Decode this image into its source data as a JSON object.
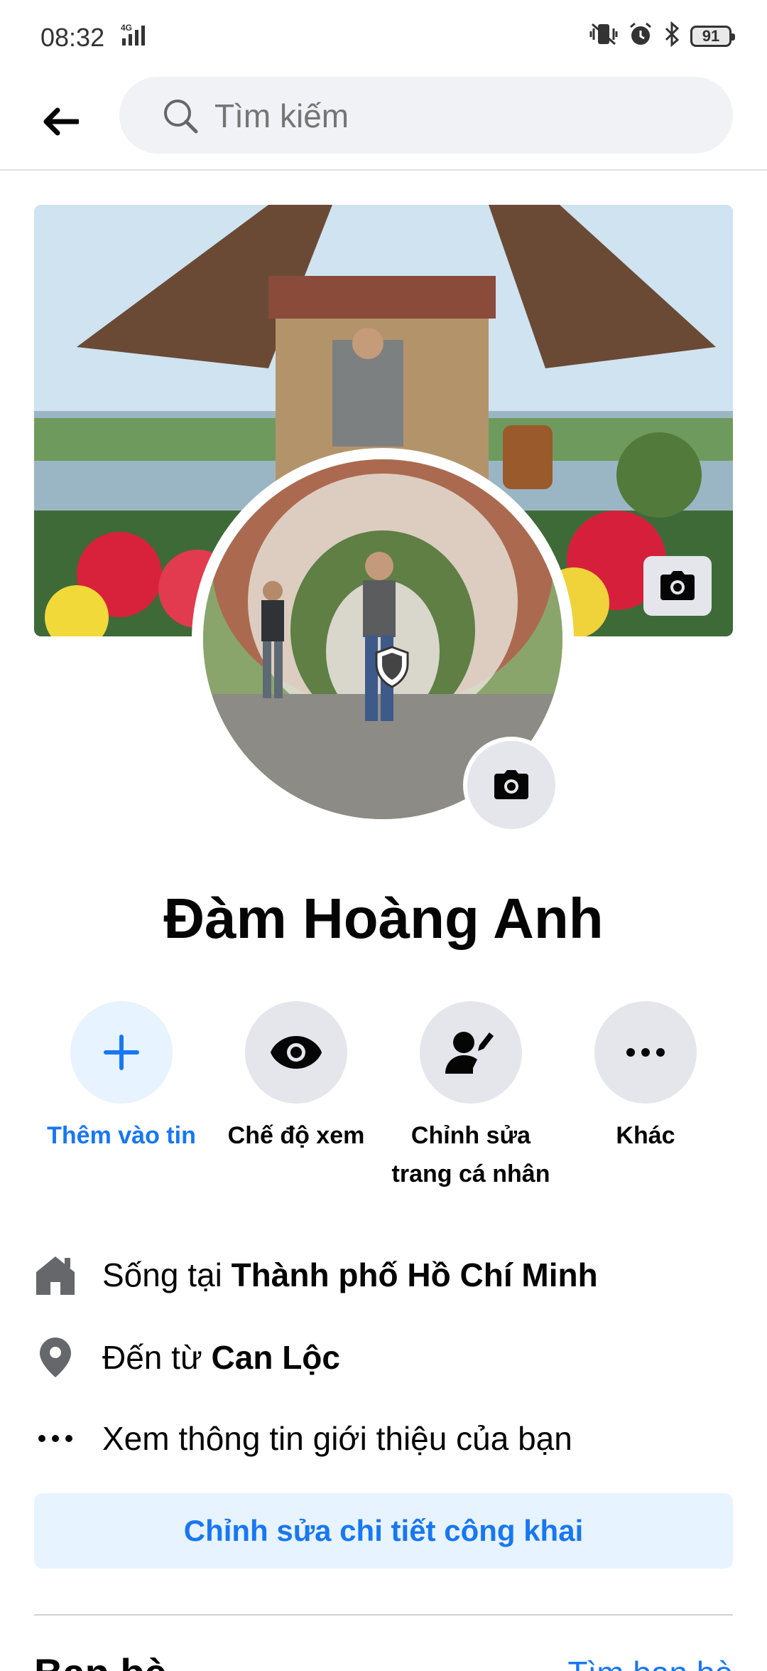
{
  "status_bar": {
    "time": "08:32",
    "network": "4G",
    "battery": "91"
  },
  "header": {
    "search_placeholder": "Tìm kiếm"
  },
  "profile": {
    "name": "Đàm Hoàng Anh"
  },
  "actions": [
    {
      "label": "Thêm vào tin",
      "icon": "plus-icon"
    },
    {
      "label": "Chế độ xem",
      "icon": "eye-icon"
    },
    {
      "label_line1": "Chỉnh sửa",
      "label_line2": "trang cá nhân",
      "icon": "edit-profile-icon"
    },
    {
      "label": "Khác",
      "icon": "more-icon"
    }
  ],
  "info": {
    "lives_prefix": "Sống tại ",
    "lives_value": "Thành phố Hồ Chí Minh",
    "from_prefix": "Đến từ ",
    "from_value": "Can Lộc",
    "about": "Xem thông tin giới thiệu của bạn"
  },
  "edit_public_label": "Chỉnh sửa chi tiết công khai",
  "friends": {
    "title": "Bạn bè",
    "find_label": "Tìm bạn bè"
  },
  "colors": {
    "accent": "#1877f2",
    "accent_light": "#e7f3ff",
    "button_gray": "#e4e6eb"
  }
}
